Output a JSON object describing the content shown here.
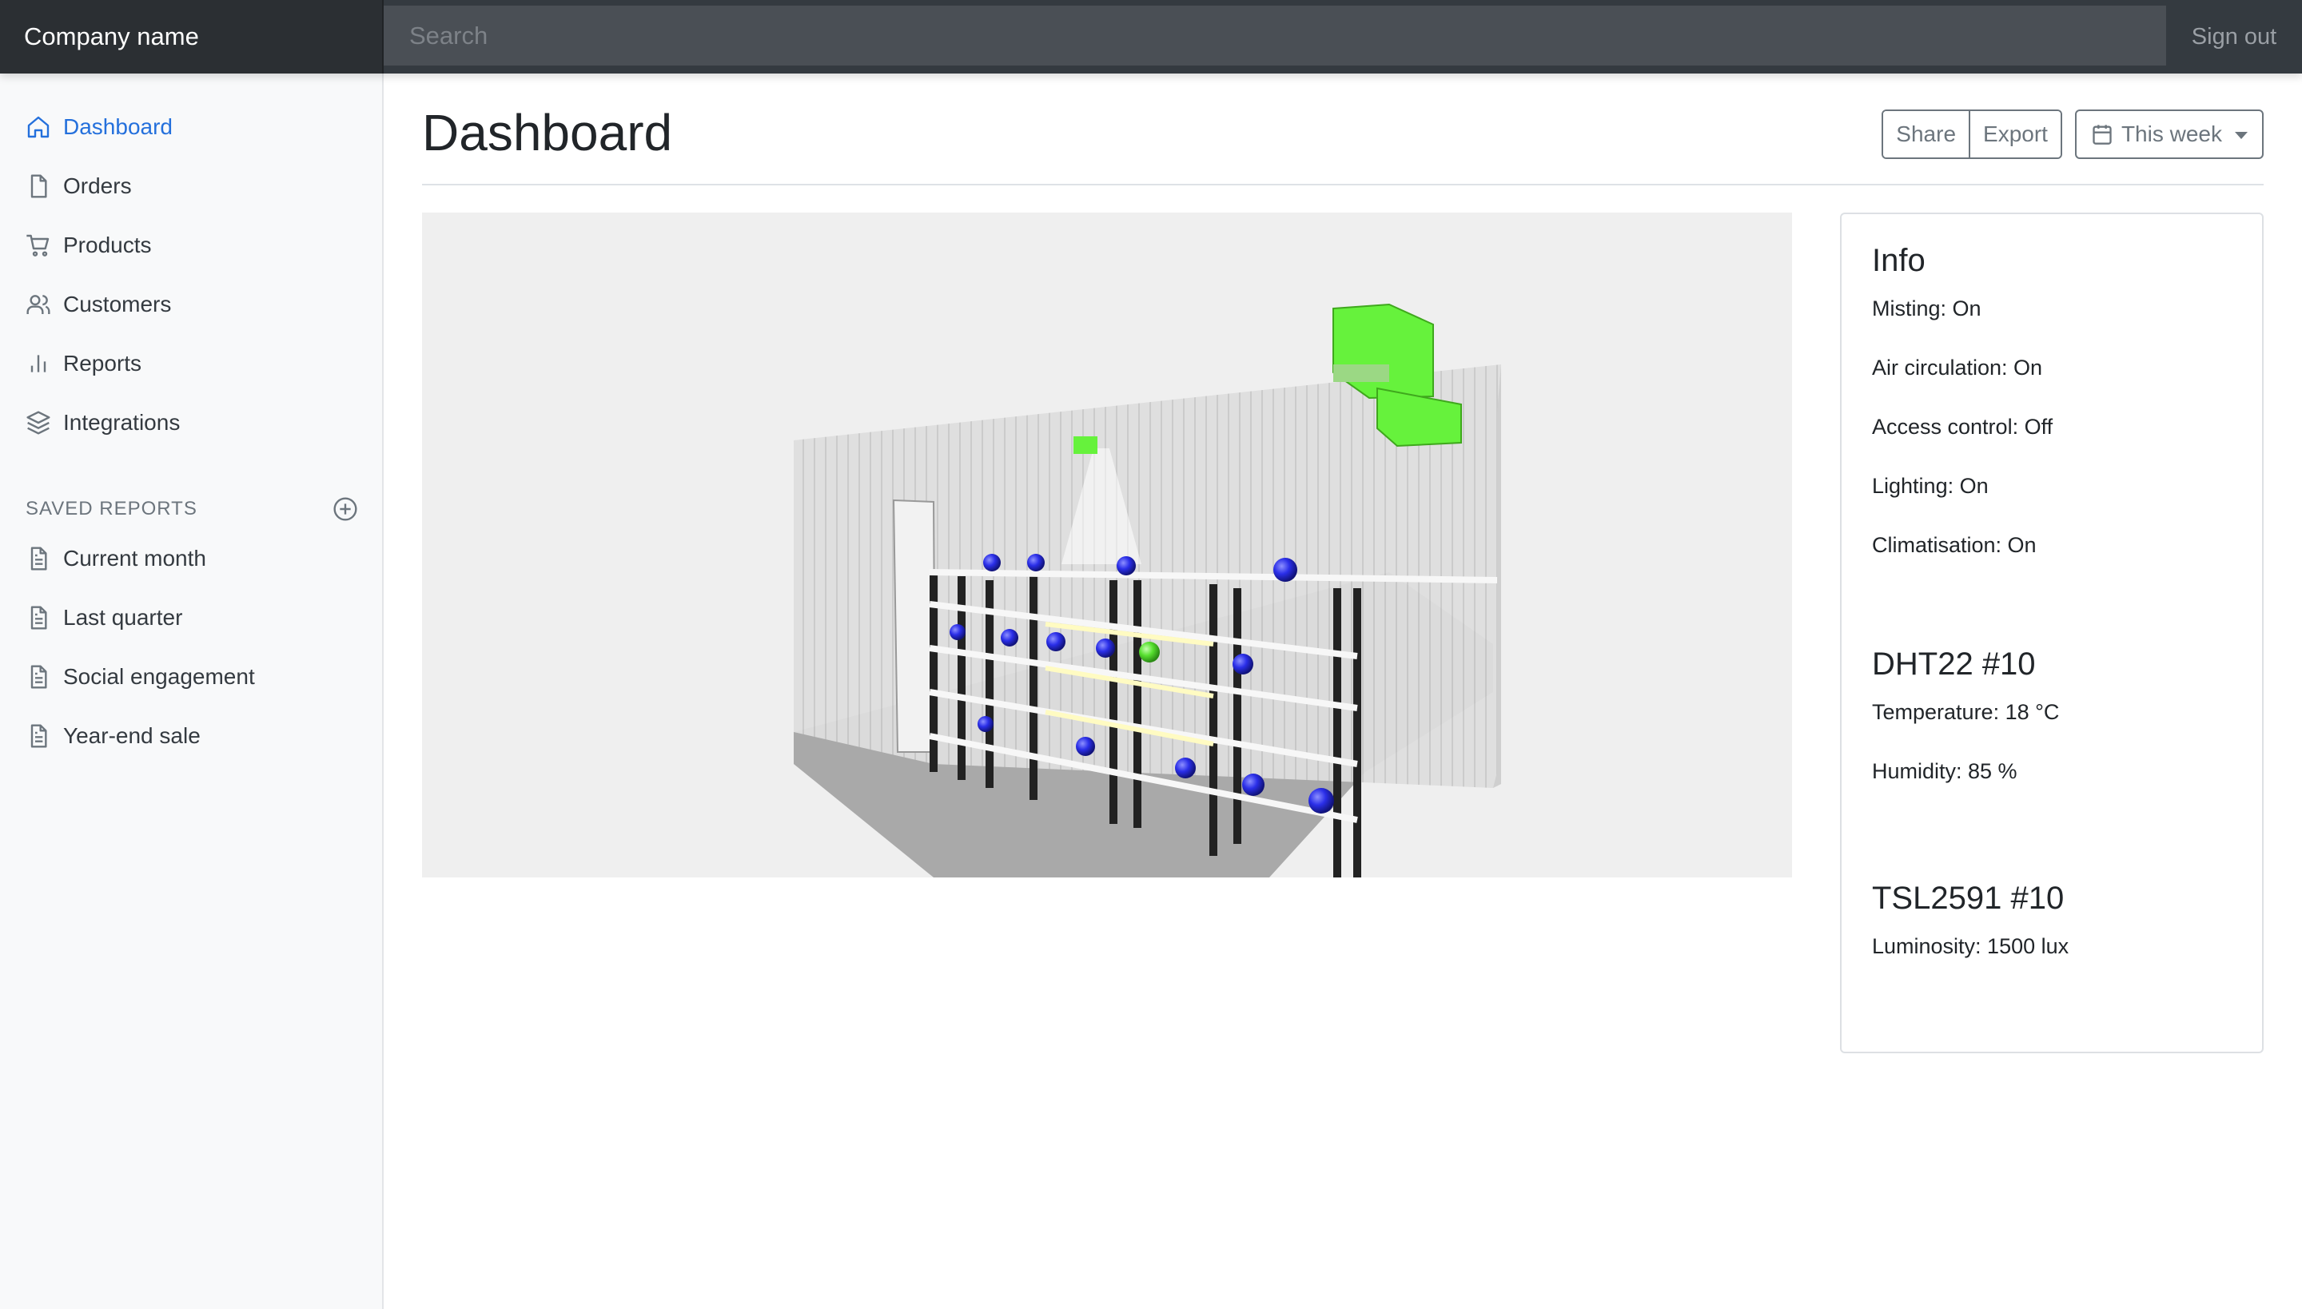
{
  "navbar": {
    "brand": "Company name",
    "search_placeholder": "Search",
    "signout": "Sign out"
  },
  "sidebar": {
    "items": [
      {
        "label": "Dashboard",
        "icon": "home-icon",
        "active": true
      },
      {
        "label": "Orders",
        "icon": "file-icon"
      },
      {
        "label": "Products",
        "icon": "cart-icon"
      },
      {
        "label": "Customers",
        "icon": "users-icon"
      },
      {
        "label": "Reports",
        "icon": "bar-chart-icon"
      },
      {
        "label": "Integrations",
        "icon": "layers-icon"
      }
    ],
    "saved_heading": "SAVED REPORTS",
    "saved": [
      {
        "label": "Current month",
        "icon": "file-text-icon"
      },
      {
        "label": "Last quarter",
        "icon": "file-text-icon"
      },
      {
        "label": "Social engagement",
        "icon": "file-text-icon"
      },
      {
        "label": "Year-end sale",
        "icon": "file-text-icon"
      }
    ]
  },
  "main": {
    "title": "Dashboard",
    "share": "Share",
    "export": "Export",
    "range": "This week"
  },
  "info": {
    "title": "Info",
    "lines": [
      "Misting: On",
      "Air circulation: On",
      "Access control: Off",
      "Lighting: On",
      "Climatisation: On"
    ],
    "dht_title": "DHT22 #10",
    "dht_lines": [
      "Temperature: 18 °C",
      "Humidity: 85 %"
    ],
    "tsl_title": "TSL2591 #10",
    "tsl_lines": [
      "Luminosity: 1500 lux"
    ]
  },
  "colors": {
    "active": "#2470dc",
    "sensor_blue": "#2a2ee8",
    "device_green": "#66f23c"
  }
}
